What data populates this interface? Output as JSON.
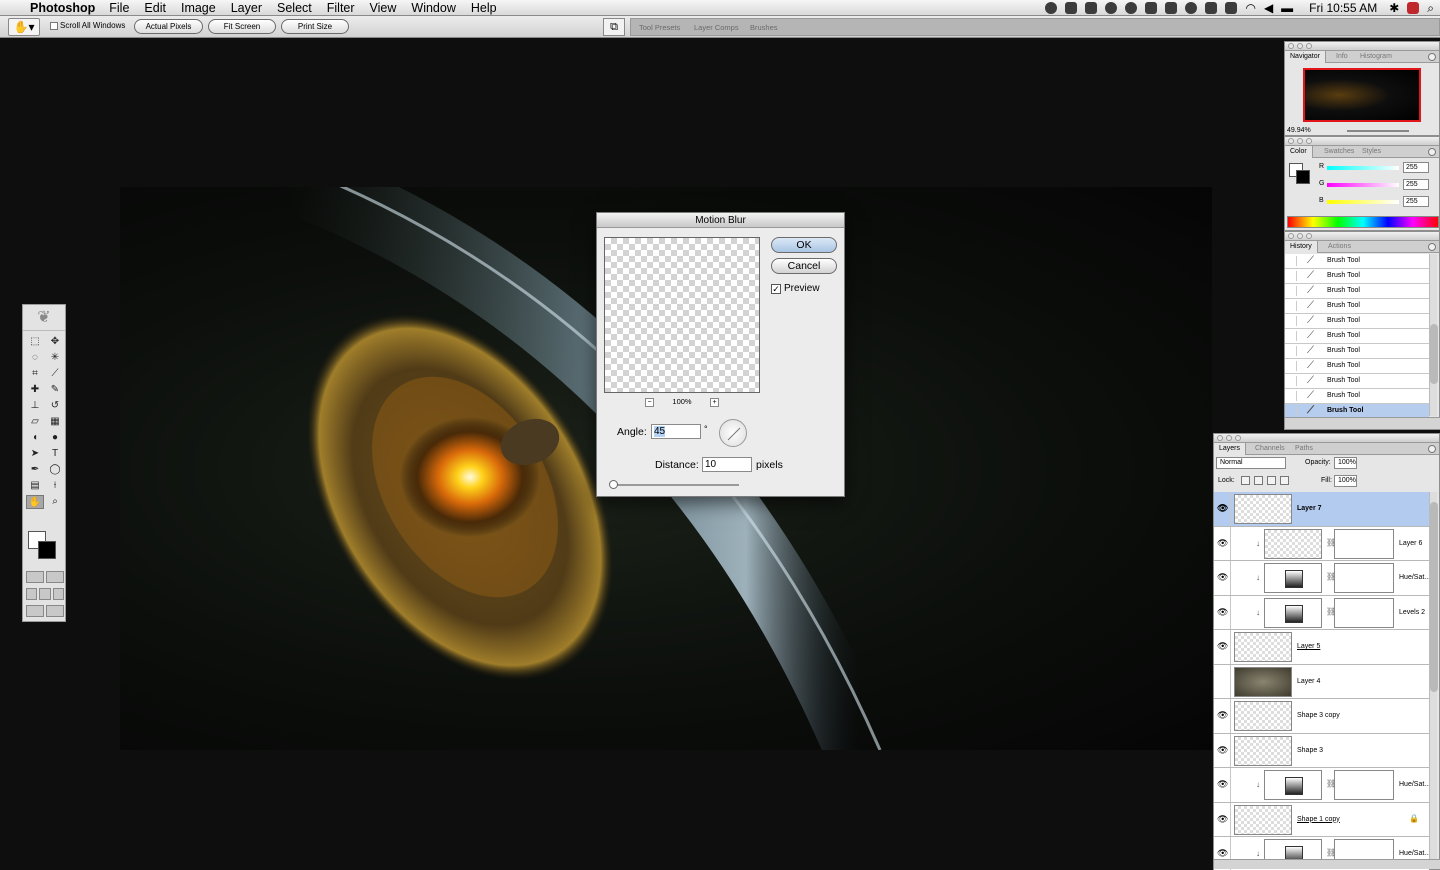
{
  "menubar": {
    "app": "Photoshop",
    "items": [
      "File",
      "Edit",
      "Image",
      "Layer",
      "Select",
      "Filter",
      "View",
      "Window",
      "Help"
    ],
    "clock": "Fri 10:55 AM"
  },
  "options": {
    "scroll_all": "Scroll All Windows",
    "actual_pixels": "Actual Pixels",
    "fit_screen": "Fit Screen",
    "print_size": "Print Size",
    "well_tabs": [
      "Tool Presets",
      "Layer Comps",
      "Brushes"
    ]
  },
  "dialog": {
    "title": "Motion Blur",
    "ok": "OK",
    "cancel": "Cancel",
    "preview_label": "Preview",
    "preview_checked": true,
    "zoom": "100%",
    "zoom_minus": "−",
    "zoom_plus": "+",
    "angle_label": "Angle:",
    "angle_value": "45",
    "degree": "°",
    "distance_label": "Distance:",
    "distance_value": "10",
    "distance_unit": "pixels"
  },
  "navigator": {
    "tabs": [
      "Navigator",
      "Info",
      "Histogram"
    ],
    "zoom": "49.94%"
  },
  "color": {
    "tabs": [
      "Color",
      "Swatches",
      "Styles"
    ],
    "r_label": "R",
    "g_label": "G",
    "b_label": "B",
    "r": "255",
    "g": "255",
    "b": "255"
  },
  "history": {
    "tabs": [
      "History",
      "Actions"
    ],
    "items": [
      "Brush Tool",
      "Brush Tool",
      "Brush Tool",
      "Brush Tool",
      "Brush Tool",
      "Brush Tool",
      "Brush Tool",
      "Brush Tool",
      "Brush Tool",
      "Brush Tool",
      "Brush Tool"
    ]
  },
  "layers": {
    "tabs": [
      "Layers",
      "Channels",
      "Paths"
    ],
    "blend_mode": "Normal",
    "opacity_label": "Opacity:",
    "opacity": "100%",
    "lock_label": "Lock:",
    "fill_label": "Fill:",
    "fill": "100%",
    "rows": [
      "Layer 7",
      "Layer 6",
      "Hue/Sat...",
      "Levels 2",
      "Layer 5",
      "Layer 4",
      "Shape 3 copy",
      "Shape 3",
      "Hue/Sat...",
      "Shape 1 copy",
      "Hue/Sat..."
    ]
  }
}
